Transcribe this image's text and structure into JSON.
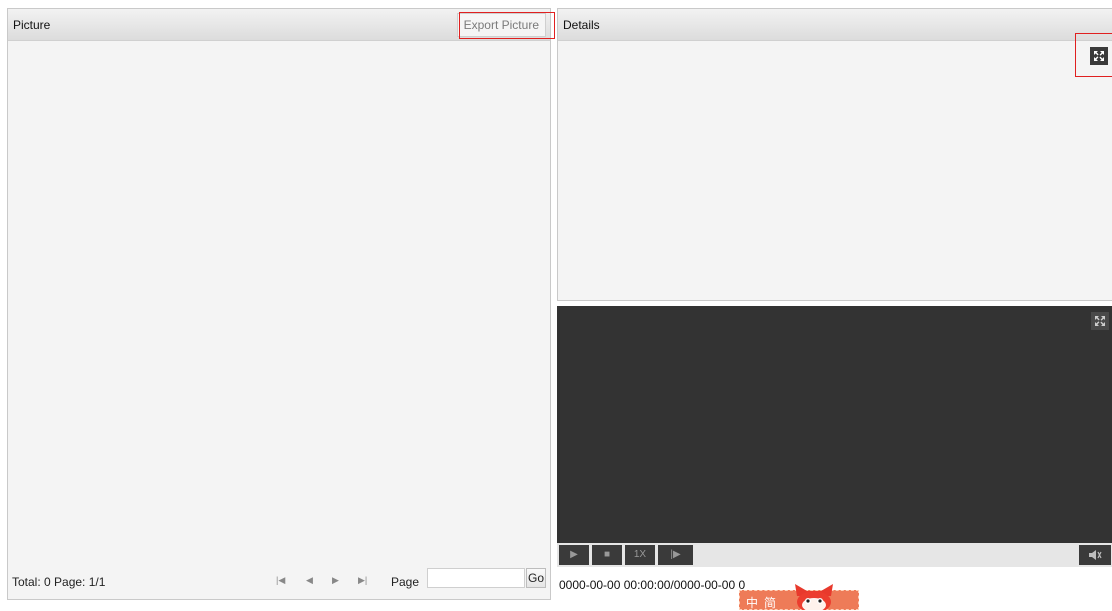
{
  "picture_panel": {
    "title": "Picture",
    "export_label": "Export Picture",
    "pager": {
      "total_text": "Total: 0  Page: 1/1",
      "first_glyph": "|◀",
      "prev_glyph": "◀",
      "next_glyph": "▶",
      "last_glyph": "▶|",
      "page_label": "Page",
      "page_value": "",
      "go_label": "Go"
    }
  },
  "details_panel": {
    "title": "Details"
  },
  "video": {
    "controls": {
      "play_glyph": "▶",
      "stop_glyph": "■",
      "speed_label": "1X",
      "step_glyph": "|▶"
    },
    "time_text": "0000-00-00 00:00:00/0000-00-00 0",
    "mascot_text": "中简"
  },
  "colors": {
    "highlight_box": "#e02020",
    "video_bg": "#333333",
    "panel_bg": "#f4f4f4"
  }
}
